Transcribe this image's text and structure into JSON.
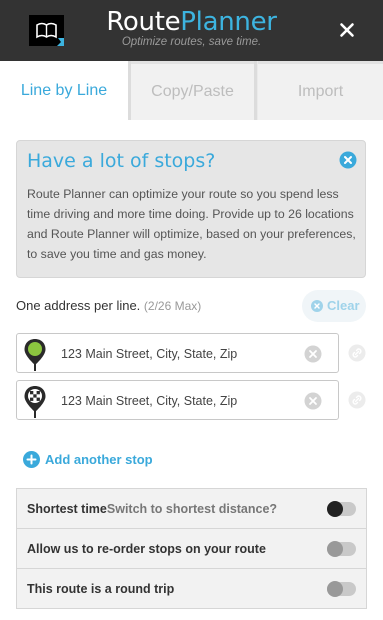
{
  "header": {
    "title_part1": "Route",
    "title_part2": "Planner",
    "subtitle": "Optimize routes, save time."
  },
  "tabs": [
    {
      "label": "Line by Line",
      "active": true
    },
    {
      "label": "Copy/Paste",
      "active": false
    },
    {
      "label": "Import",
      "active": false
    }
  ],
  "info": {
    "title": "Have a lot of stops?",
    "body": "Route Planner can optimize your route so you spend less time driving and more time doing. Provide up to 26 locations and Route Planner will optimize, based on your preferences, to save you time and gas money."
  },
  "addresses": {
    "label": "One address per line.",
    "count": "(2/26 Max)",
    "clear_label": "Clear",
    "stops": [
      {
        "placeholder": "123 Main Street, City, State, Zip",
        "value": "",
        "pin": "start-pin-icon"
      },
      {
        "placeholder": "123 Main Street, City, State, Zip",
        "value": "",
        "pin": "finish-flag-pin-icon"
      }
    ],
    "add_label": "Add another stop"
  },
  "options": {
    "shortest_time": "Shortest time",
    "switch_link": "Switch to shortest distance?",
    "reorder": "Allow us to re-order stops on your route",
    "round_trip": "This route is a round trip",
    "shortest_time_on": true,
    "reorder_on": false,
    "round_trip_on": false
  },
  "colors": {
    "accent": "#3aa9db",
    "header_bg": "#333333",
    "start_pin": "#8cc63f"
  }
}
